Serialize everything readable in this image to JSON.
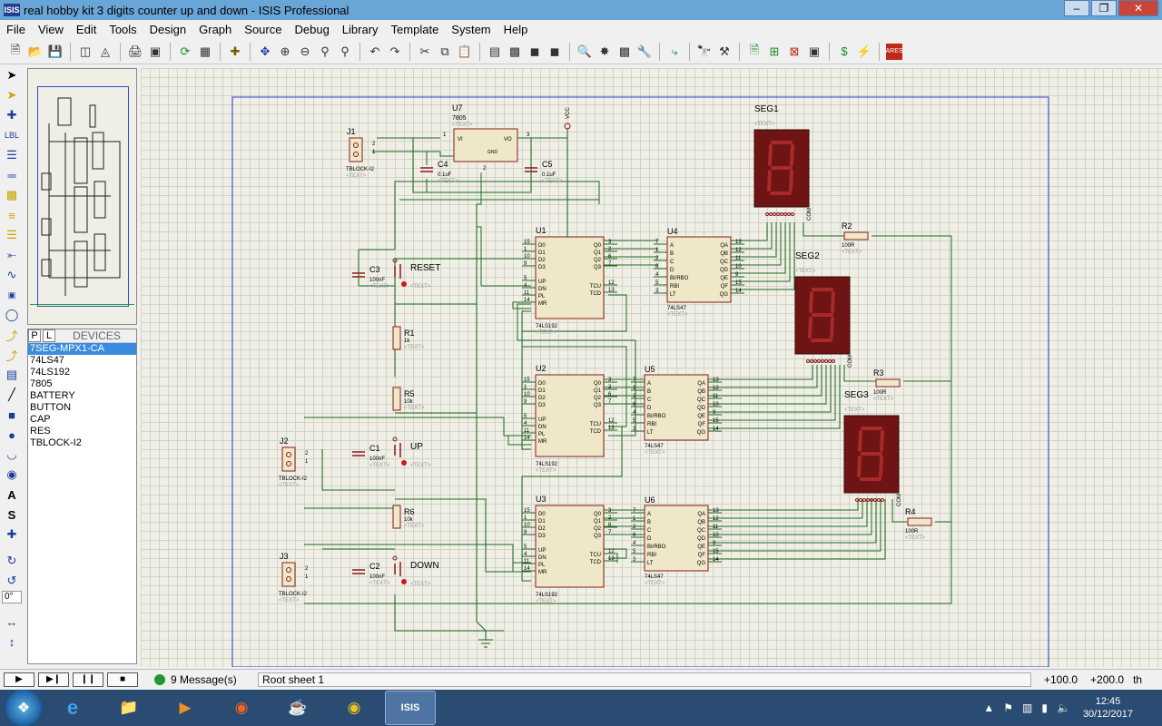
{
  "window": {
    "title": "real hobby kit 3 digits counter up and down - ISIS Professional",
    "app_icon_text": "ISIS"
  },
  "menu": [
    "File",
    "View",
    "Edit",
    "Tools",
    "Design",
    "Graph",
    "Source",
    "Debug",
    "Library",
    "Template",
    "System",
    "Help"
  ],
  "devices_panel": {
    "tab_p": "P",
    "tab_l": "L",
    "title": "DEVICES",
    "items": [
      "7SEG-MPX1-CA",
      "74LS47",
      "74LS192",
      "7805",
      "BATTERY",
      "BUTTON",
      "CAP",
      "RES",
      "TBLOCK-I2"
    ],
    "selected_index": 0
  },
  "left_tools": {
    "angle_value": "0°"
  },
  "schematic": {
    "regulator": {
      "ref": "U7",
      "part": "7805",
      "pin_vi": "VI",
      "pin_vo": "VO",
      "pin_gnd": "GND",
      "pin1": "1",
      "pin3": "3",
      "pin2": "2"
    },
    "vcc_label": "VCC",
    "text_placeholder": "<TEXT>",
    "terminal_blocks": [
      {
        "ref": "J1",
        "part": "TBLOCK-I2"
      },
      {
        "ref": "J2",
        "part": "TBLOCK-I2"
      },
      {
        "ref": "J3",
        "part": "TBLOCK-I2"
      }
    ],
    "capacitors": [
      {
        "ref": "C4",
        "value": "0.1uF"
      },
      {
        "ref": "C5",
        "value": "0.1uF"
      },
      {
        "ref": "C3",
        "value": "100nF"
      },
      {
        "ref": "C1",
        "value": "100nF"
      },
      {
        "ref": "C2",
        "value": "100nF"
      }
    ],
    "resistors": [
      {
        "ref": "R1",
        "value": "1k"
      },
      {
        "ref": "R5",
        "value": "10k"
      },
      {
        "ref": "R6",
        "value": "10k"
      },
      {
        "ref": "R2",
        "value": "100R"
      },
      {
        "ref": "R3",
        "value": "100R"
      },
      {
        "ref": "R4",
        "value": "100R"
      }
    ],
    "buttons": [
      "RESET",
      "UP",
      "DOWN"
    ],
    "counters": [
      {
        "ref": "U1",
        "part": "74LS192"
      },
      {
        "ref": "U2",
        "part": "74LS192"
      },
      {
        "ref": "U3",
        "part": "74LS192"
      }
    ],
    "decoders": [
      {
        "ref": "U4",
        "part": "74LS47"
      },
      {
        "ref": "U5",
        "part": "74LS47"
      },
      {
        "ref": "U6",
        "part": "74LS47"
      }
    ],
    "displays": [
      "SEG1",
      "SEG2",
      "SEG3"
    ],
    "com_label": "COM",
    "counter_pins_left": [
      "D0",
      "D1",
      "D2",
      "D3",
      "UP",
      "DN",
      "PL",
      "MR"
    ],
    "counter_pins_left_num": [
      "15",
      "1",
      "10",
      "9",
      "5",
      "4",
      "11",
      "14"
    ],
    "counter_pins_right": [
      "Q0",
      "Q1",
      "Q2",
      "Q3",
      "TCU",
      "TCD"
    ],
    "counter_pins_right_num": [
      "3",
      "2",
      "6",
      "7",
      "12",
      "13"
    ],
    "decoder_pins_left": [
      "A",
      "B",
      "C",
      "D",
      "BI/RBO",
      "RBI",
      "LT"
    ],
    "decoder_pins_left_num": [
      "7",
      "1",
      "2",
      "6",
      "4",
      "5",
      "3"
    ],
    "decoder_pins_right": [
      "QA",
      "QB",
      "QC",
      "QD",
      "QE",
      "QF",
      "QG"
    ],
    "decoder_pins_right_num": [
      "13",
      "12",
      "11",
      "10",
      "9",
      "15",
      "14"
    ],
    "tblock_pins": [
      "2",
      "1"
    ]
  },
  "status": {
    "messages": "9 Message(s)",
    "sheet": "Root sheet 1",
    "coord_x": "+100.0",
    "coord_y": "+200.0",
    "units": "th"
  },
  "taskbar": {
    "time": "12:45",
    "date": "30/12/2017",
    "apps": [
      "internet-explorer-icon",
      "file-explorer-icon",
      "media-player-icon",
      "firefox-icon",
      "java-icon",
      "chrome-icon",
      "isis-icon"
    ]
  },
  "colors": {
    "wire": "#1d6b1d",
    "component": "#8b1a1a",
    "component_fill": "#efe8c8",
    "grid": "#d2d2c8",
    "segment_display": "#6e1414",
    "sheet_border": "#2c3fcf"
  }
}
